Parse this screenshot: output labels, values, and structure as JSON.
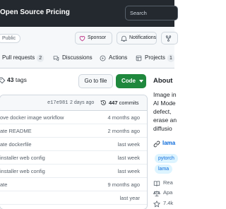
{
  "header": {
    "nav": [
      "Open Source",
      "Pricing"
    ],
    "search_placeholder": "Search"
  },
  "repo": {
    "visibility": "Public",
    "sponsor_label": "Sponsor",
    "notifications_label": "Notifications",
    "fork_label": ""
  },
  "tabs": [
    {
      "label": "Pull requests",
      "count": "2"
    },
    {
      "label": "Discussions",
      "count": ""
    },
    {
      "label": "Actions",
      "count": ""
    },
    {
      "label": "Projects",
      "count": "1"
    }
  ],
  "toolbar": {
    "tags_count": "43",
    "tags_label": "tags",
    "go_to_file": "Go to file",
    "code": "Code"
  },
  "latest_commit": {
    "sha": "e17e981",
    "ago": "2 days ago",
    "commits_count": "447",
    "commits_label": "commits"
  },
  "files": [
    {
      "message": "ove docker image workflow",
      "time": "4 months ago"
    },
    {
      "message": "ate README",
      "time": "2 months ago"
    },
    {
      "message": "ate dockerfile",
      "time": "last week"
    },
    {
      "message": "installer web config",
      "time": "last week"
    },
    {
      "message": "installer web config",
      "time": "last week"
    },
    {
      "message": "ate",
      "time": "9 months ago"
    },
    {
      "message": "",
      "time": "last year"
    }
  ],
  "about": {
    "title": "About",
    "description": [
      "Image in",
      "AI Mode",
      "defect,",
      "erase an",
      "diffusio"
    ],
    "link": "lama",
    "topics": [
      "pytorch",
      "lama"
    ],
    "meta": [
      {
        "icon": "book-icon",
        "label": "Rea"
      },
      {
        "icon": "law-icon",
        "label": "Apa"
      },
      {
        "icon": "star-icon",
        "label": "7.4k"
      }
    ]
  },
  "colors": {
    "header_bg": "#24292f",
    "code_button": "#1f883d",
    "link": "#0969da"
  }
}
